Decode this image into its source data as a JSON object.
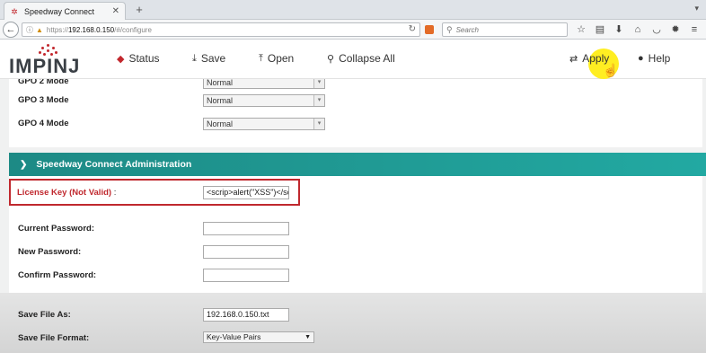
{
  "browser": {
    "tab_title": "Speedway Connect",
    "url_protocol": "https://",
    "url_host": "192.168.0.150",
    "url_path": "/#/configure",
    "search_placeholder": "Search"
  },
  "app": {
    "logo_text": "IMPINJ",
    "nav": {
      "status": "Status",
      "save": "Save",
      "open": "Open",
      "collapse_all": "Collapse All",
      "apply": "Apply",
      "help": "Help"
    }
  },
  "gpo": {
    "gpo2_label": "GPO 2 Mode",
    "gpo2_value": "Normal",
    "gpo3_label": "GPO 3 Mode",
    "gpo3_value": "Normal",
    "gpo4_label": "GPO 4 Mode",
    "gpo4_value": "Normal"
  },
  "admin": {
    "section_title": "Speedway Connect Administration",
    "license_label": "License Key (Not Valid)",
    "license_colon": ":",
    "license_value": "<scrip>alert(\"XSS\")</sc",
    "current_password_label": "Current Password:",
    "new_password_label": "New Password:",
    "confirm_password_label": "Confirm Password:",
    "save_file_as_label": "Save File As:",
    "save_file_as_value": "192.168.0.150.txt",
    "save_file_format_label": "Save File Format:",
    "save_file_format_value": "Key-Value Pairs"
  },
  "colors": {
    "accent_teal": "#1d8a85",
    "error_red": "#c0282e",
    "highlight_yellow": "#ffee22"
  }
}
